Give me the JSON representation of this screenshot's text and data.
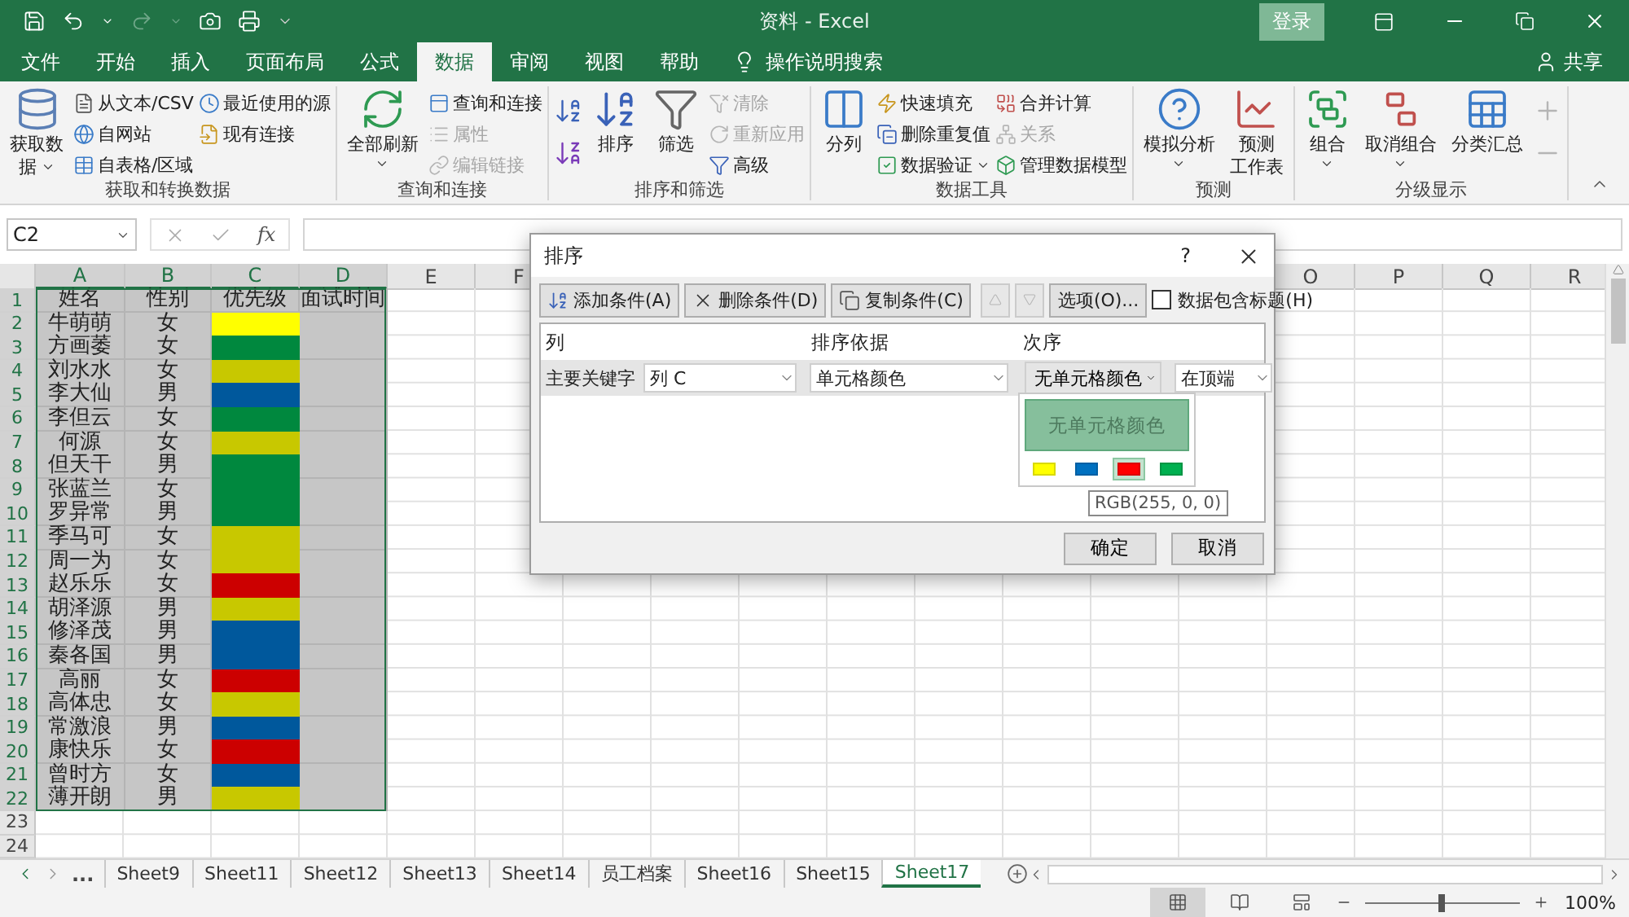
{
  "titlebar": {
    "title": "资料 - Excel",
    "sign_in": "登录"
  },
  "tabs": [
    {
      "label": "文件",
      "selected": false
    },
    {
      "label": "开始",
      "selected": false
    },
    {
      "label": "插入",
      "selected": false
    },
    {
      "label": "页面布局",
      "selected": false
    },
    {
      "label": "公式",
      "selected": false
    },
    {
      "label": "数据",
      "selected": true
    },
    {
      "label": "审阅",
      "selected": false
    },
    {
      "label": "视图",
      "selected": false
    },
    {
      "label": "帮助",
      "selected": false
    }
  ],
  "tell_me": "操作说明搜索",
  "share": "共享",
  "ribbon": [
    {
      "name": "获取和转换数据",
      "columns": [
        {
          "kind": "large",
          "lines": [
            "获取数",
            "据"
          ],
          "dropdown": true
        },
        {
          "kind": "smalls",
          "items": [
            {
              "label": "从文本/CSV",
              "disabled": false
            },
            {
              "label": "自网站",
              "disabled": false
            },
            {
              "label": "自表格/区域",
              "disabled": false
            }
          ]
        },
        {
          "kind": "smalls",
          "items": [
            {
              "label": "最近使用的源",
              "disabled": false
            },
            {
              "label": "现有连接",
              "disabled": false
            }
          ]
        }
      ]
    },
    {
      "name": "查询和连接",
      "columns": [
        {
          "kind": "large",
          "lines": [
            "全部刷新"
          ],
          "dropdown": true
        },
        {
          "kind": "smalls",
          "items": [
            {
              "label": "查询和连接",
              "disabled": false
            },
            {
              "label": "属性",
              "disabled": true
            },
            {
              "label": "编辑链接",
              "disabled": true
            }
          ]
        }
      ]
    },
    {
      "name": "排序和筛选",
      "columns": [
        {
          "kind": "icons",
          "disabled": false
        },
        {
          "kind": "large",
          "lines": [
            "排序"
          ],
          "dropdown": false
        },
        {
          "kind": "large",
          "lines": [
            "筛选"
          ],
          "dropdown": false
        },
        {
          "kind": "smalls",
          "items": [
            {
              "label": "清除",
              "disabled": true
            },
            {
              "label": "重新应用",
              "disabled": true
            },
            {
              "label": "高级",
              "disabled": false
            }
          ]
        }
      ]
    },
    {
      "name": "数据工具",
      "columns": [
        {
          "kind": "large",
          "lines": [
            "分列"
          ],
          "dropdown": false
        },
        {
          "kind": "smalls",
          "items": [
            {
              "label": "快速填充",
              "disabled": false
            },
            {
              "label": "删除重复值",
              "disabled": false
            },
            {
              "label": "数据验证",
              "disabled": false,
              "dropdown": true
            }
          ]
        },
        {
          "kind": "smalls",
          "items": [
            {
              "label": "合并计算",
              "disabled": false
            },
            {
              "label": "关系",
              "disabled": true
            },
            {
              "label": "管理数据模型",
              "disabled": false
            }
          ]
        }
      ]
    },
    {
      "name": "预测",
      "columns": [
        {
          "kind": "large",
          "lines": [
            "模拟分析"
          ],
          "dropdown": true
        },
        {
          "kind": "large",
          "lines": [
            "预测",
            "工作表"
          ],
          "dropdown": false
        }
      ]
    },
    {
      "name": "分级显示",
      "columns": [
        {
          "kind": "large",
          "lines": [
            "组合"
          ],
          "dropdown": true
        },
        {
          "kind": "large",
          "lines": [
            "取消组合"
          ],
          "dropdown": true
        },
        {
          "kind": "large",
          "lines": [
            "分类汇总"
          ],
          "dropdown": false
        },
        {
          "kind": "icons",
          "disabled": true
        }
      ]
    }
  ],
  "formula_bar": {
    "name_box": "C2",
    "fx": "fx"
  },
  "sheet": {
    "column_headers_left": [
      {
        "label": "A",
        "selected": true
      },
      {
        "label": "B",
        "selected": true
      },
      {
        "label": "C",
        "selected": true
      },
      {
        "label": "D",
        "selected": true
      },
      {
        "label": "E",
        "selected": false
      },
      {
        "label": "F",
        "selected": false
      }
    ],
    "column_headers_right": [
      {
        "label": "O",
        "selected": false
      },
      {
        "label": "P",
        "selected": false
      },
      {
        "label": "Q",
        "selected": false
      },
      {
        "label": "R",
        "selected": false
      }
    ],
    "row_numbers": [
      {
        "label": "1",
        "selected": true
      },
      {
        "label": "2",
        "selected": true
      },
      {
        "label": "3",
        "selected": true
      },
      {
        "label": "4",
        "selected": true
      },
      {
        "label": "5",
        "selected": true
      },
      {
        "label": "6",
        "selected": true
      },
      {
        "label": "7",
        "selected": true
      },
      {
        "label": "8",
        "selected": true
      },
      {
        "label": "9",
        "selected": true
      },
      {
        "label": "10",
        "selected": true
      },
      {
        "label": "11",
        "selected": true
      },
      {
        "label": "12",
        "selected": true
      },
      {
        "label": "13",
        "selected": true
      },
      {
        "label": "14",
        "selected": true
      },
      {
        "label": "15",
        "selected": true
      },
      {
        "label": "16",
        "selected": true
      },
      {
        "label": "17",
        "selected": true
      },
      {
        "label": "18",
        "selected": true
      },
      {
        "label": "19",
        "selected": true
      },
      {
        "label": "20",
        "selected": true
      },
      {
        "label": "21",
        "selected": true
      },
      {
        "label": "22",
        "selected": true
      },
      {
        "label": "23",
        "selected": false
      },
      {
        "label": "24",
        "selected": false
      }
    ],
    "header": [
      "姓名",
      "性别",
      "优先级",
      "面试时间"
    ],
    "rows": [
      {
        "name": "牛萌萌",
        "gender": "女",
        "color": "#ffff00"
      },
      {
        "name": "方画萎",
        "gender": "女",
        "color": "#00883e"
      },
      {
        "name": "刘水水",
        "gender": "女",
        "color": "#c8c800"
      },
      {
        "name": "李大仙",
        "gender": "男",
        "color": "#00589c"
      },
      {
        "name": "李但云",
        "gender": "女",
        "color": "#00883e"
      },
      {
        "name": "何源",
        "gender": "女",
        "color": "#c8c800"
      },
      {
        "name": "但天干",
        "gender": "男",
        "color": "#00883e"
      },
      {
        "name": "张蓝兰",
        "gender": "女",
        "color": "#00883e"
      },
      {
        "name": "罗异常",
        "gender": "男",
        "color": "#00883e"
      },
      {
        "name": "季马可",
        "gender": "女",
        "color": "#c8c800"
      },
      {
        "name": "周一为",
        "gender": "女",
        "color": "#c8c800"
      },
      {
        "name": "赵乐乐",
        "gender": "女",
        "color": "#cc0000"
      },
      {
        "name": "胡泽源",
        "gender": "男",
        "color": "#c8c800"
      },
      {
        "name": "修泽茂",
        "gender": "男",
        "color": "#00589c"
      },
      {
        "name": "秦各国",
        "gender": "男",
        "color": "#00589c"
      },
      {
        "name": "高丽",
        "gender": "女",
        "color": "#cc0000"
      },
      {
        "name": "高体忠",
        "gender": "女",
        "color": "#c8c800"
      },
      {
        "name": "常激浪",
        "gender": "男",
        "color": "#00589c"
      },
      {
        "name": "康快乐",
        "gender": "女",
        "color": "#cc0000"
      },
      {
        "name": "曾时方",
        "gender": "女",
        "color": "#00589c"
      },
      {
        "name": "薄开朗",
        "gender": "男",
        "color": "#c8c800"
      }
    ]
  },
  "dialog": {
    "title": "排序",
    "help": "?",
    "toolbar": [
      {
        "kind": "add",
        "label": "添加条件(A)"
      },
      {
        "kind": "delete",
        "label": "删除条件(D)"
      },
      {
        "kind": "copy",
        "label": "复制条件(C)"
      }
    ],
    "move_up": {
      "disabled": true
    },
    "move_down": {
      "disabled": true
    },
    "options": "选项(O)...",
    "has_headers": {
      "label": "数据包含标题(H)",
      "checked": false
    },
    "columns": [
      "列",
      "排序依据",
      "次序"
    ],
    "rows": [
      {
        "label": "主要关键字",
        "column": "列 C",
        "sort_on": "单元格颜色",
        "order": "无单元格颜色",
        "position": "在顶端",
        "selected": true
      }
    ],
    "color_menu": {
      "none": "无单元格颜色",
      "swatches": [
        {
          "color": "#ffff00",
          "selected": false
        },
        {
          "color": "#0070c0",
          "selected": false
        },
        {
          "color": "#ff0000",
          "selected": true
        },
        {
          "color": "#00b050",
          "selected": false
        }
      ]
    },
    "tooltip": "RGB(255, 0, 0)",
    "buttons": [
      "确定",
      "取消"
    ]
  },
  "sheet_tabs": {
    "more": "...",
    "tabs": [
      {
        "label": "Sheet9",
        "selected": false
      },
      {
        "label": "Sheet11",
        "selected": false
      },
      {
        "label": "Sheet12",
        "selected": false
      },
      {
        "label": "Sheet13",
        "selected": false
      },
      {
        "label": "Sheet14",
        "selected": false
      },
      {
        "label": "员工档案",
        "selected": false
      },
      {
        "label": "Sheet16",
        "selected": false
      },
      {
        "label": "Sheet15",
        "selected": false
      },
      {
        "label": "Sheet17",
        "selected": true
      }
    ]
  },
  "status_bar": {
    "views": [
      {
        "selected": true
      },
      {
        "selected": false
      },
      {
        "selected": false
      }
    ],
    "zoom": {
      "level": 0.5,
      "reading": "100%"
    }
  }
}
